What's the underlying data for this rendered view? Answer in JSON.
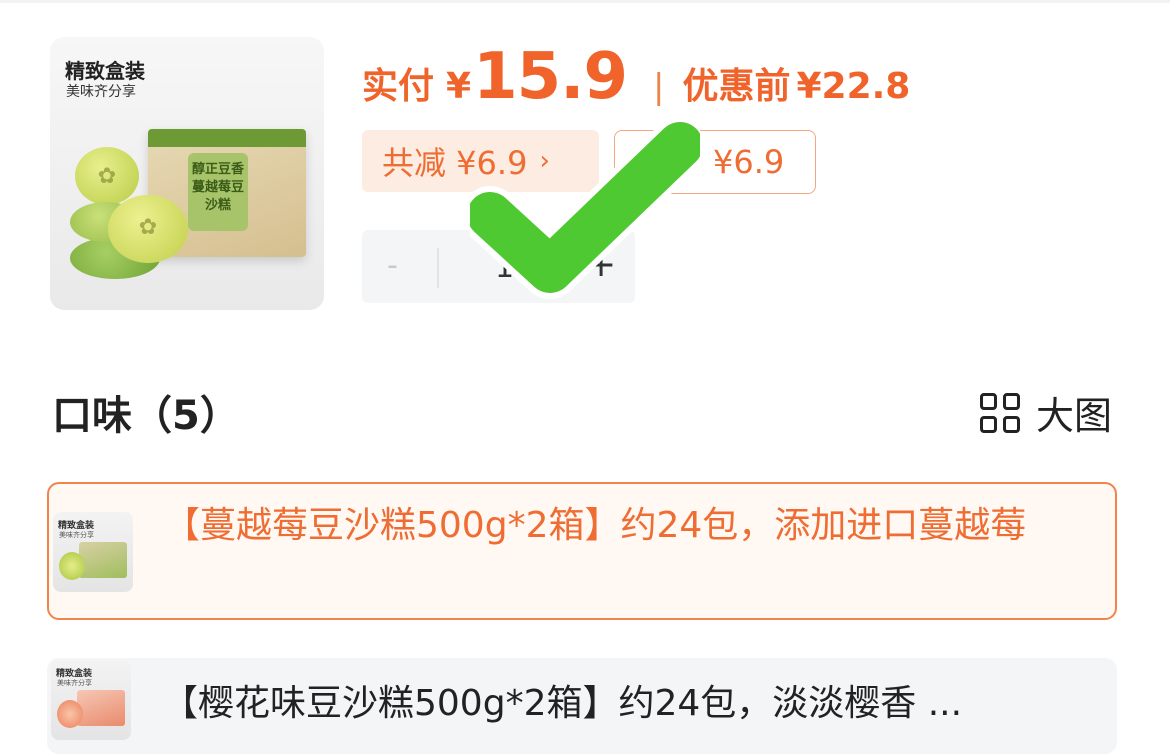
{
  "product": {
    "image_title": "精致盒装",
    "image_subtitle": "美味齐分享",
    "image_box_text": "醇正豆香 蔓越莓豆沙糕"
  },
  "price": {
    "label": "实付",
    "currency": "¥",
    "main": "15.9",
    "separator": "|",
    "original_label": "优惠前",
    "original": "¥22.8"
  },
  "coupons": {
    "total_discount": "共减 ¥6.9",
    "chevron": "›",
    "coupon_text": "¥6.9"
  },
  "quantity": {
    "minus": "-",
    "value": "1",
    "plus": "+"
  },
  "flavor": {
    "title": "口味（5）",
    "big_view_label": "大图"
  },
  "options": [
    {
      "text": "【蔓越莓豆沙糕500g*2箱】约24包，添加进口蔓越莓",
      "selected": true,
      "thumb_title": "精致盒装",
      "thumb_subtitle": "美味齐分享"
    },
    {
      "text": "【樱花味豆沙糕500g*2箱】约24包，淡淡樱香 ...",
      "selected": false,
      "thumb_title": "精致盒装",
      "thumb_subtitle": "美味齐分享"
    }
  ],
  "colors": {
    "accent": "#f0632a",
    "checkmark": "#4fc931",
    "selected_border": "#f0844a"
  }
}
